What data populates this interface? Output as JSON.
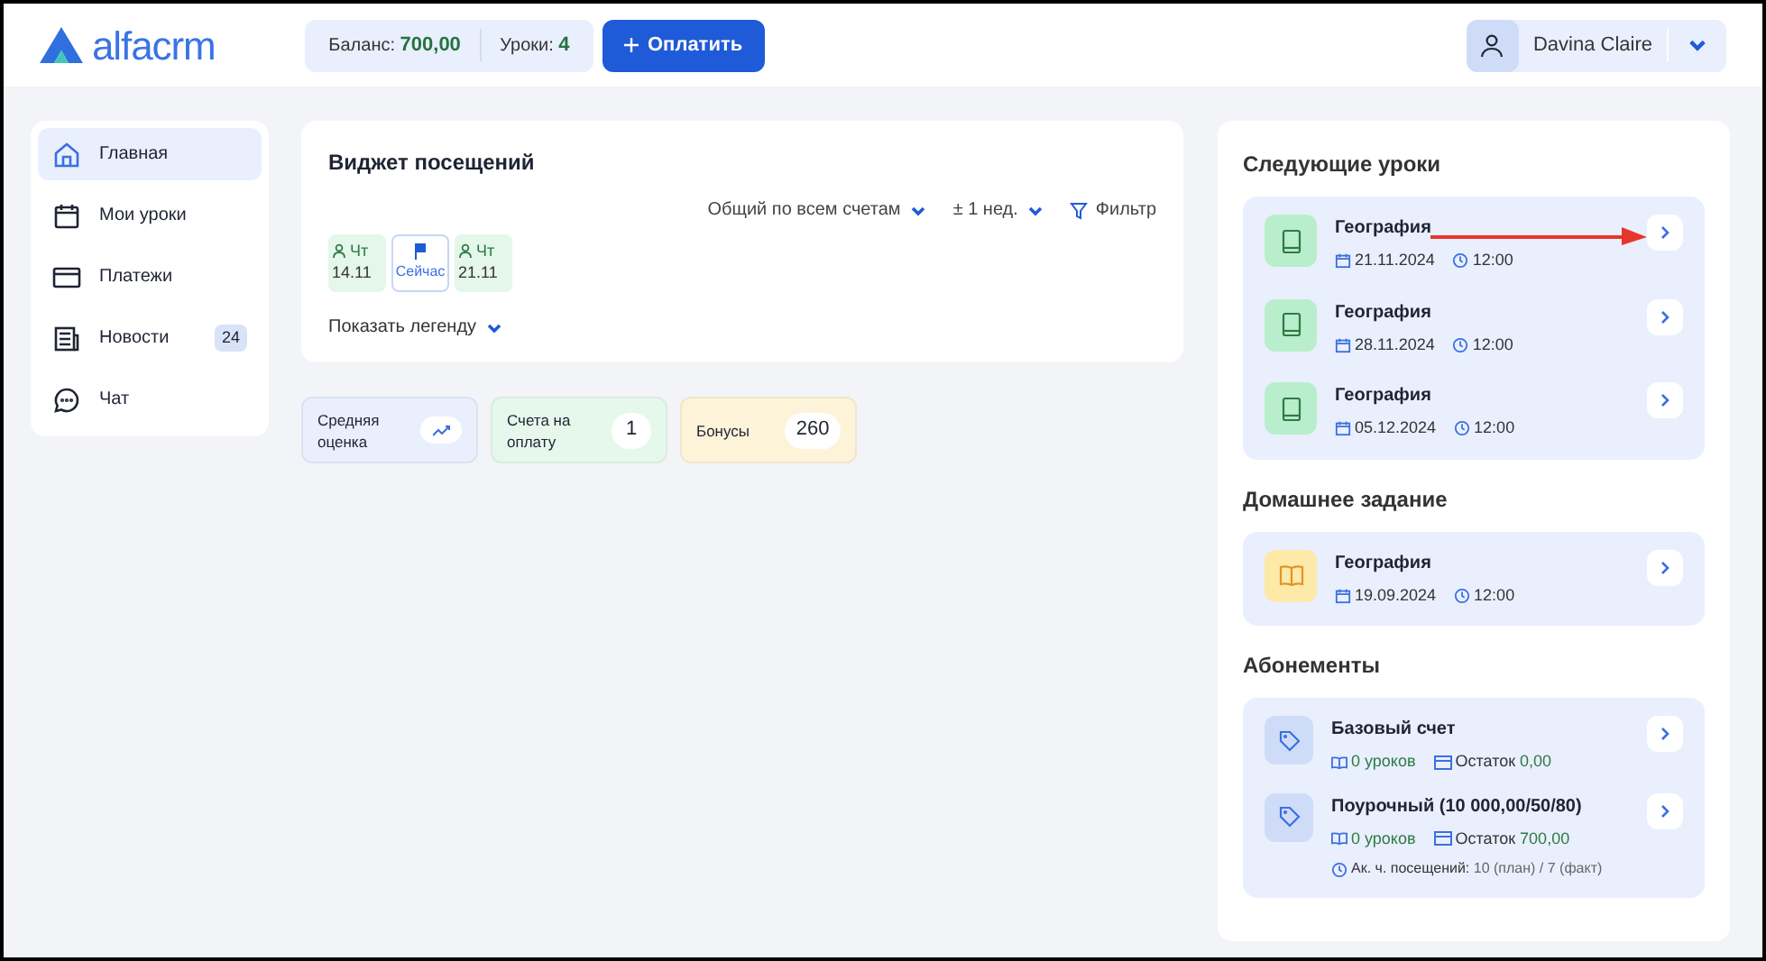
{
  "header": {
    "logo": "alfacrm",
    "balance_label": "Баланс:",
    "balance_value": "700,00",
    "lessons_label": "Уроки:",
    "lessons_value": "4",
    "pay_button": "Оплатить",
    "user_name": "Davina Claire"
  },
  "sidebar": {
    "items": [
      {
        "label": "Главная",
        "kind": "home",
        "selected": true
      },
      {
        "label": "Мои уроки",
        "kind": "calendar",
        "selected": false
      },
      {
        "label": "Платежи",
        "kind": "card",
        "selected": false
      },
      {
        "label": "Новости",
        "kind": "news",
        "selected": false,
        "badge": "24"
      },
      {
        "label": "Чат",
        "kind": "chat",
        "selected": false
      }
    ]
  },
  "attendance_widget": {
    "title": "Виджет посещений",
    "filters": [
      {
        "label": "Общий по всем счетам",
        "kind": "dropdown"
      },
      {
        "label": "± 1 нед.",
        "kind": "dropdown"
      },
      {
        "label": "Фильтр",
        "kind": "filter"
      }
    ],
    "days": [
      {
        "kind": "attended",
        "day": "Чт",
        "date": "14.11"
      },
      {
        "kind": "now",
        "label": "Сейчас"
      },
      {
        "kind": "attended",
        "day": "Чт",
        "date": "21.11"
      }
    ],
    "legend_toggle": "Показать легенду"
  },
  "stats": [
    {
      "label": "Средняя оценка",
      "kind": "trend",
      "color": "#e9effd"
    },
    {
      "label": "Счета на оплату",
      "kind": "count",
      "value": "1",
      "color": "#e6f8ec"
    },
    {
      "label": "Бонусы",
      "kind": "count",
      "value": "260",
      "color": "#fdf3d9"
    }
  ],
  "next_lessons": {
    "title": "Следующие уроки",
    "items": [
      {
        "subject": "География",
        "date": "21.11.2024",
        "time": "12:00"
      },
      {
        "subject": "География",
        "date": "28.11.2024",
        "time": "12:00"
      },
      {
        "subject": "География",
        "date": "05.12.2024",
        "time": "12:00"
      }
    ]
  },
  "homework": {
    "title": "Домашнее задание",
    "items": [
      {
        "subject": "География",
        "date": "19.09.2024",
        "time": "12:00"
      }
    ]
  },
  "subscriptions": {
    "title": "Абонементы",
    "items": [
      {
        "name": "Базовый счет",
        "lessons": "0 уроков",
        "balance_label": "Остаток",
        "balance": "0,00"
      },
      {
        "name": "Поурочный (10 000,00/50/80)",
        "lessons": "0 уроков",
        "balance_label": "Остаток",
        "balance": "700,00",
        "visits_label": "Ак. ч. посещений:",
        "visits": "10 (план) / 7 (факт)"
      }
    ]
  }
}
